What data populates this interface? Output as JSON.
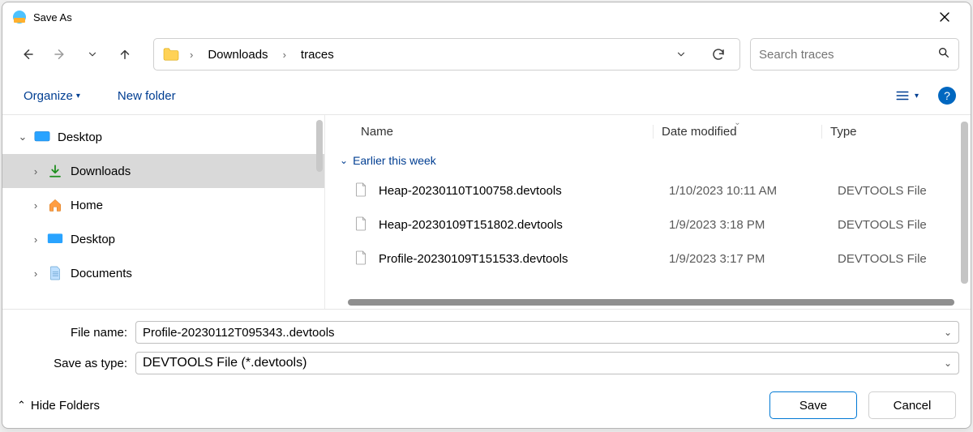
{
  "window": {
    "title": "Save As"
  },
  "breadcrumb": {
    "items": [
      "Downloads",
      "traces"
    ]
  },
  "search": {
    "placeholder": "Search traces"
  },
  "toolbar": {
    "organize": "Organize",
    "new_folder": "New folder"
  },
  "tree": {
    "root": {
      "label": "Desktop",
      "expanded": true
    },
    "items": [
      {
        "label": "Downloads",
        "icon": "download",
        "selected": true
      },
      {
        "label": "Home",
        "icon": "home",
        "selected": false
      },
      {
        "label": "Desktop",
        "icon": "desktop",
        "selected": false
      },
      {
        "label": "Documents",
        "icon": "documents",
        "selected": false
      }
    ]
  },
  "list": {
    "headers": {
      "name": "Name",
      "date": "Date modified",
      "type": "Type"
    },
    "group": "Earlier this week",
    "rows": [
      {
        "name": "Heap-20230110T100758.devtools",
        "date": "1/10/2023 10:11 AM",
        "type": "DEVTOOLS File"
      },
      {
        "name": "Heap-20230109T151802.devtools",
        "date": "1/9/2023 3:18 PM",
        "type": "DEVTOOLS File"
      },
      {
        "name": "Profile-20230109T151533.devtools",
        "date": "1/9/2023 3:17 PM",
        "type": "DEVTOOLS File"
      }
    ]
  },
  "fields": {
    "file_name_label": "File name:",
    "file_name_value": "Profile-20230112T095343..devtools",
    "save_type_label": "Save as type:",
    "save_type_value": "DEVTOOLS File (*.devtools)"
  },
  "footer": {
    "hide_folders": "Hide Folders",
    "save": "Save",
    "cancel": "Cancel"
  }
}
